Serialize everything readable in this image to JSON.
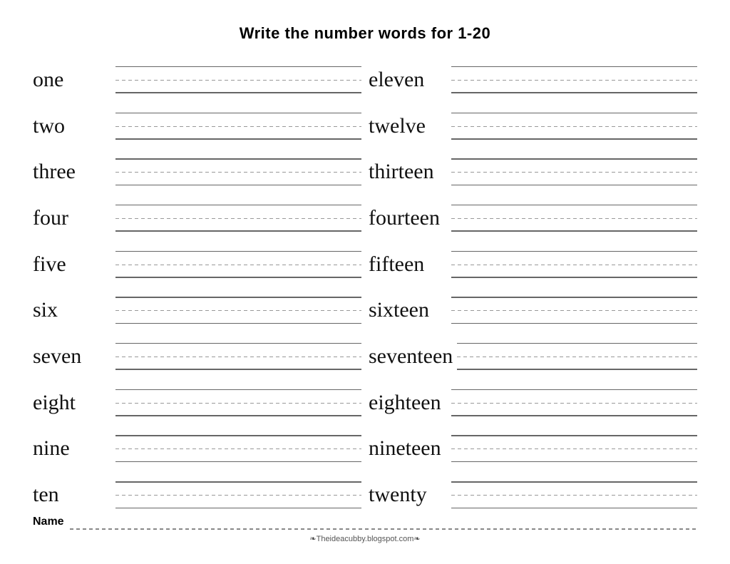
{
  "title": "Write the number words for  1-20",
  "col1": {
    "words": [
      "one",
      "two",
      "three",
      "four",
      "five",
      "six",
      "seven",
      "eight",
      "nine",
      "ten"
    ]
  },
  "col2": {
    "words": [
      "eleven",
      "twelve",
      "thirteen",
      "fourteen",
      "fifteen",
      "sixteen",
      "seventeen",
      "eighteen",
      "nineteen",
      "twenty"
    ]
  },
  "footer": {
    "name_label": "Name",
    "website": "❧Theideacubby.blogspot.com❧"
  }
}
